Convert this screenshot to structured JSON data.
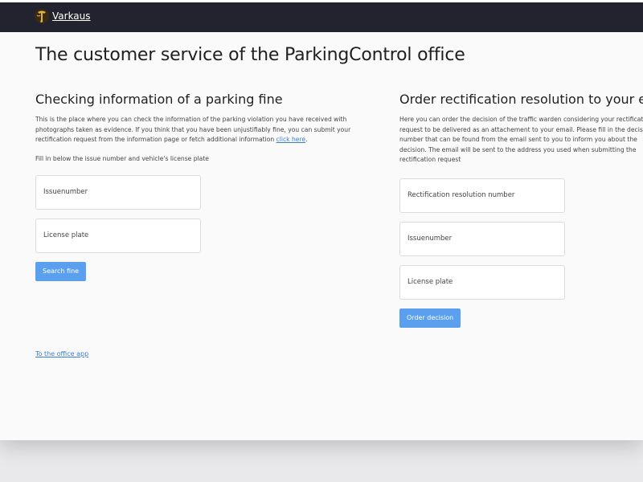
{
  "topbar": {
    "brand_label": "Varkaus",
    "bg_color": "#23232f"
  },
  "page_title": "The customer service of the ParkingControl office",
  "left": {
    "heading": "Checking information of a parking fine",
    "description": "This is the place where you can check the information of the parking violation you have received with photographs taken as evidence. If you think that you have been unjustifiably fine, you can submit your rectification request from the information page or fetch additional information",
    "description_link": "click here",
    "hint": "Fill in below the issue number and vehicle's license plate",
    "fields": [
      {
        "placeholder": "Issuenumber"
      },
      {
        "placeholder": "License plate"
      }
    ],
    "submit_label": "Search fine"
  },
  "right": {
    "heading": "Order rectification resolution to your email",
    "description": "Here you can order the decision of the traffic warden considering your rectification request to be delivered as an attachement to your email. Please fill in the decision number that can be found from the email sent to you to inform you about the decision. The email will be sent to the address you used when submitting the rectification request",
    "fields": [
      {
        "placeholder": "Rectification resolution number"
      },
      {
        "placeholder": "Issuenumber"
      },
      {
        "placeholder": "License plate"
      }
    ],
    "submit_label": "Order decision"
  },
  "footer_link": "To the office app",
  "colors": {
    "accent_button": "#5aa0ee",
    "link": "#3a7bd5"
  }
}
